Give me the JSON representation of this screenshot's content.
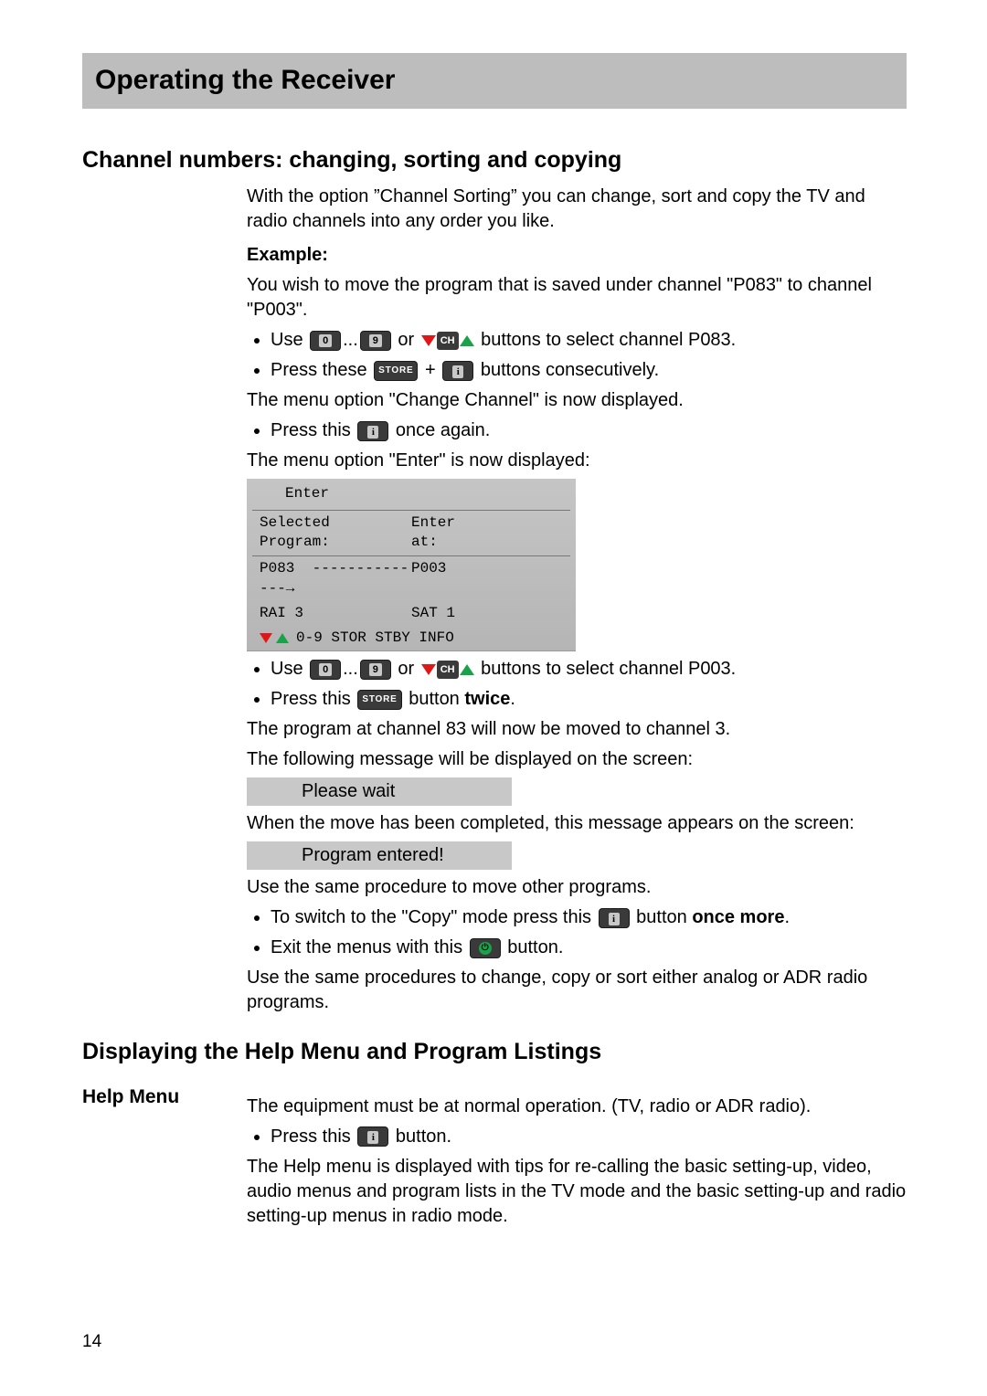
{
  "page_number": "14",
  "banner": "Operating the Receiver",
  "section1": {
    "heading": "Channel numbers: changing, sorting and copying",
    "intro": "With the option ”Channel Sorting” you can change, sort and copy the TV and radio channels into any order you like.",
    "example_label": "Example:",
    "example_intro": "You wish to move the program that is saved under channel \"P083\" to channel \"P003\".",
    "b1_a": "Use ",
    "b1_b": " or ",
    "b1_c": " buttons to select channel P083.",
    "b2_a": "Press these ",
    "b2_b": " + ",
    "b2_c": " buttons consecutively.",
    "p_after_b2": "The menu option \"Change Channel\" is now displayed.",
    "b3_a": "Press this ",
    "b3_b": " once again.",
    "p_after_b3": "The menu option \"Enter\" is now displayed:",
    "osd": {
      "title": "Enter",
      "left_label": "Selected Program:",
      "left_label_l1": "Selected",
      "left_label_l2": "Program:",
      "right_label_l1": "Enter",
      "right_label_l2": "at:",
      "src_ch": "P083",
      "arrow": "--------------→",
      "dst_ch": "P003",
      "src_name": "RAI 3",
      "dst_name": "SAT 1",
      "help_text": "0-9  STOR  STBY  INFO"
    },
    "b4_a": "Use ",
    "b4_b": " or ",
    "b4_c": " buttons to select channel P003.",
    "b5_a": "Press this ",
    "b5_b": " button ",
    "b5_bold": "twice",
    "b5_c": ".",
    "p_after_b5a": "The program at channel 83 will now be moved to channel 3.",
    "p_after_b5b": "The following message will be displayed on the screen:",
    "msg1": "Please wait",
    "p_after_msg1": "When the move has been completed, this message appears on the screen:",
    "msg2": "Program entered!",
    "p_after_msg2": "Use the same procedure to move other programs.",
    "b6_a": "To switch to the \"Copy\" mode press this ",
    "b6_b": " button ",
    "b6_bold": "once more",
    "b6_c": ".",
    "b7_a": "Exit the menus with this ",
    "b7_b": " button.",
    "p_final": "Use the same procedures to change, copy or sort either analog or ADR radio programs."
  },
  "section2": {
    "heading": "Displaying the Help Menu and Program Listings",
    "sub": "Help Menu",
    "intro": "The equipment must be at normal operation. (TV, radio or ADR radio).",
    "b1_a": "Press this ",
    "b1_b": " button.",
    "p_body": "The Help menu is displayed with tips for re-calling the basic setting-up, video, audio menus and program lists in the TV mode and the basic setting-up and radio setting-up menus in radio mode."
  },
  "keys": {
    "zero": "0",
    "nine": "9",
    "store": "STORE",
    "info": "i",
    "ch": "CH",
    "power": "⏻"
  }
}
